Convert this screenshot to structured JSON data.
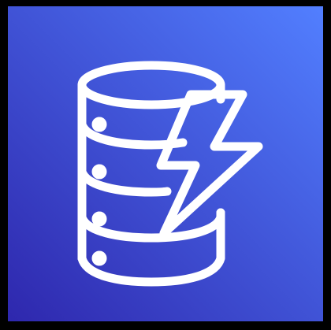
{
  "icon": {
    "name": "database-lightning-icon",
    "gradient_start": "#2E27AD",
    "gradient_end": "#527FFF",
    "stroke_color": "#FFFFFF",
    "frame_color": "#000000"
  }
}
